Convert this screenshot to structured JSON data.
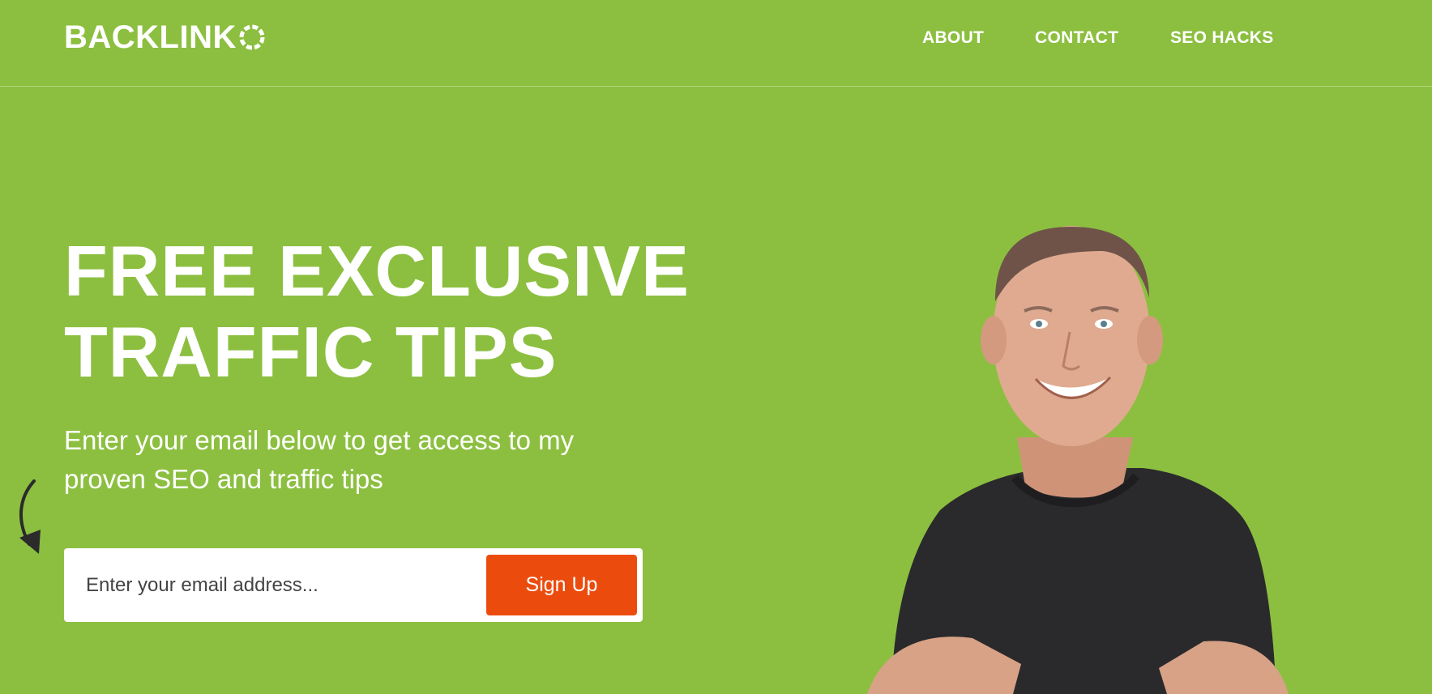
{
  "brand": {
    "name": "BACKLINK",
    "logo_icon": "dashed-circle-icon"
  },
  "nav": {
    "items": [
      {
        "label": "ABOUT"
      },
      {
        "label": "CONTACT"
      },
      {
        "label": "SEO HACKS"
      }
    ]
  },
  "hero": {
    "headline_line1": "FREE EXCLUSIVE",
    "headline_line2": "TRAFFIC TIPS",
    "subtext_line1": "Enter your email below to get access to my",
    "subtext_line2": "proven SEO and traffic tips",
    "arrow_icon": "curved-arrow-icon"
  },
  "signup_form": {
    "email_placeholder": "Enter your email address...",
    "email_value": "",
    "button_label": "Sign Up"
  },
  "colors": {
    "background": "#8cbf40",
    "button": "#eb4c0e",
    "text": "#ffffff"
  }
}
